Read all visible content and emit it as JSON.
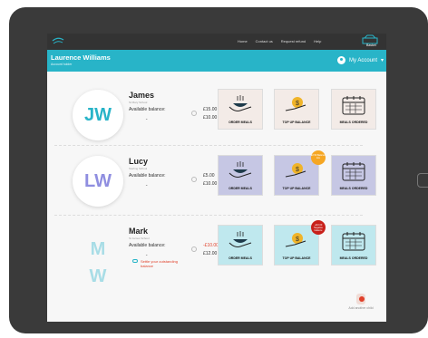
{
  "nav": {
    "items": [
      "Home",
      "Contact us",
      "Request refund",
      "Help"
    ],
    "basket_label": "Basket"
  },
  "account": {
    "name": "Laurence Williams",
    "role": "Account holder",
    "menu_label": "My Account"
  },
  "tiles": {
    "order": "ORDER MEALS",
    "topup": "TOP UP BALANCE",
    "ordered": "MEALS ORDERED"
  },
  "children": [
    {
      "initials": "JW",
      "name": "James",
      "school": "St Mary School",
      "balance_label": "Available balance:",
      "balance1": "£15.00",
      "balance2": "£10.00",
      "colors": {
        "initials": "#28b4c8",
        "tiles": "#f3ebe7"
      }
    },
    {
      "initials": "LW",
      "name": "Lucy",
      "school": "Sterling School",
      "balance_label": "Available balance:",
      "balance1": "£5.00",
      "balance2": "£10.00",
      "badge": "£2.50 Balance low",
      "colors": {
        "initials": "#8f8ee0",
        "tiles": "#c6c7e4",
        "badge": "#f5a623"
      }
    },
    {
      "initials": "MW",
      "initials_lines": [
        "M",
        "W"
      ],
      "name": "Mark",
      "school": "St James School",
      "balance_label": "Available balance:",
      "balance1": "-£10.00",
      "balance2": "£12.00",
      "badge": "-£10.00 Negative balance",
      "warning": "Settle your outstanding balance",
      "colors": {
        "initials": "#a8dde6",
        "tiles": "#bfe8ee",
        "badge": "#c8201a",
        "negative": "#e0402a"
      }
    }
  ],
  "add_child_label": "Add another child"
}
